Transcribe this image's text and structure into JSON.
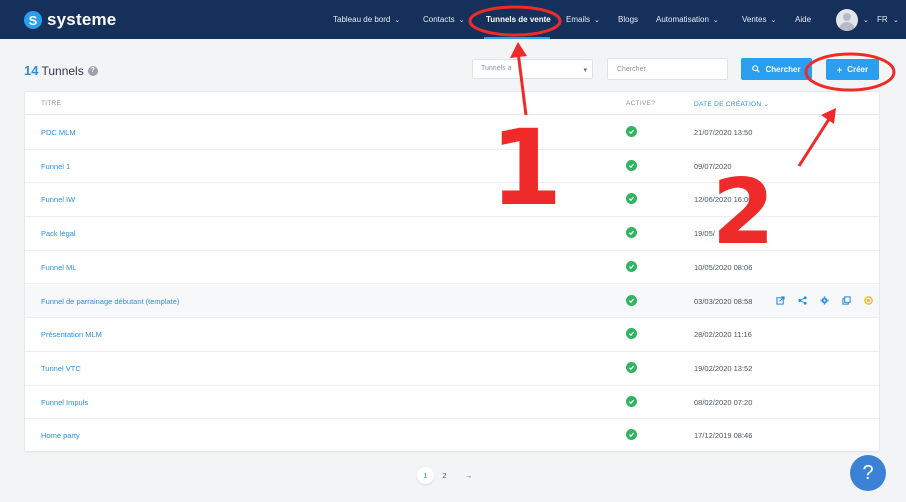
{
  "brand": {
    "name": "systeme",
    "mark": "S"
  },
  "nav": {
    "items": [
      {
        "label": "Tableau de bord",
        "dropdown": true
      },
      {
        "label": "Contacts",
        "dropdown": true
      },
      {
        "label": "Tunnels de vente",
        "dropdown": false,
        "active": true
      },
      {
        "label": "Emails",
        "dropdown": true
      },
      {
        "label": "Blogs",
        "dropdown": false
      },
      {
        "label": "Automatisation",
        "dropdown": true
      },
      {
        "label": "Ventes",
        "dropdown": true
      },
      {
        "label": "Aide",
        "dropdown": false
      }
    ],
    "language": "FR",
    "chevron": "⌄"
  },
  "header": {
    "count": "14",
    "title": "Tunnels",
    "help": "?",
    "filter_select": "Tunnels a",
    "search_placeholder": "Chercher",
    "search_button": "Chercher",
    "create_button": "Créer",
    "create_plus": "+"
  },
  "table": {
    "columns": {
      "title": "TITRE",
      "active": "ACTIVE?",
      "date": "DATE DE CRÉATION",
      "sort_arrow": "⌄"
    },
    "rows": [
      {
        "name": "PDC MLM",
        "date": "21/07/2020 13:50"
      },
      {
        "name": "Funnel 1",
        "date": "09/07/2020"
      },
      {
        "name": "Funnel IW",
        "date": "12/06/2020 16:00"
      },
      {
        "name": "Pack légal",
        "date": "19/05/"
      },
      {
        "name": "Funnel ML",
        "date": "10/05/2020 08:06"
      },
      {
        "name": "Funnel de parrainage débutant (template)",
        "date": "03/03/2020 08:58"
      },
      {
        "name": "Présentation MLM",
        "date": "28/02/2020 11:16"
      },
      {
        "name": "Tunnel VTC",
        "date": "19/02/2020 13:52"
      },
      {
        "name": "Funnel Impuls",
        "date": "08/02/2020 07:20"
      },
      {
        "name": "Home party",
        "date": "17/12/2019 08:46"
      }
    ],
    "hover_row_index": 5,
    "row_actions": [
      "external-link-icon",
      "share-icon",
      "gear-icon",
      "copy-icon",
      "coin-icon"
    ]
  },
  "pagination": {
    "pages": [
      "1",
      "2"
    ],
    "current": "1",
    "next": "→"
  },
  "help_fab": "?",
  "annotations": {
    "step1": "1",
    "step2": "2"
  },
  "colors": {
    "navbar": "#15305a",
    "accent": "#2b9ef0",
    "link": "#2b8fe0",
    "active_check": "#2fb561",
    "annotation": "#ee2a2a",
    "coin": "#f0b400"
  }
}
